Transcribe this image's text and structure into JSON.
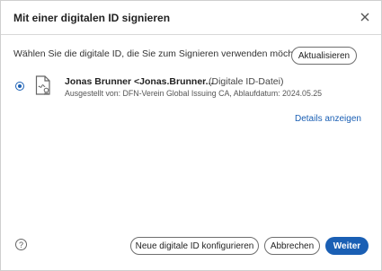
{
  "dialog": {
    "title": "Mit einer digitalen ID signieren",
    "close_icon": "close-icon"
  },
  "main": {
    "prompt": "Wählen Sie die digitale ID, die Sie zum Signieren verwenden möchten:",
    "refresh_label": "Aktualisieren",
    "ids": [
      {
        "selected": true,
        "icon": "certificate-icon",
        "name": "Jonas Brunner <Jonas.Brunner...",
        "type": "(Digitale ID-Datei)",
        "meta": "Ausgestellt von: DFN-Verein Global Issuing CA, Ablaufdatum: 2024.05.25"
      }
    ],
    "details_label": "Details anzeigen"
  },
  "footer": {
    "help_icon": "help-icon",
    "help_glyph": "?",
    "new_id_label": "Neue digitale ID konfigurieren",
    "cancel_label": "Abbrechen",
    "next_label": "Weiter"
  },
  "colors": {
    "accent": "#1a5fb4",
    "border": "#6e6e6e"
  }
}
